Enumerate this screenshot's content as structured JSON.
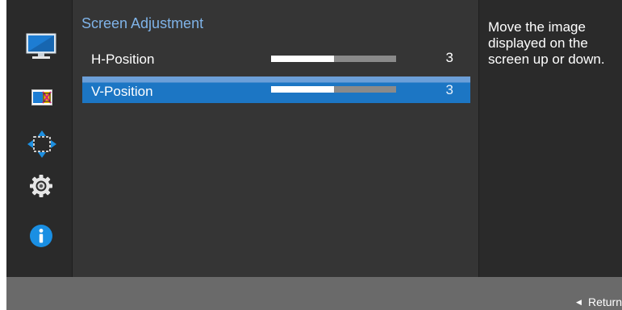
{
  "sidebar": {
    "items": [
      {
        "name": "picture-icon"
      },
      {
        "name": "color-icon"
      },
      {
        "name": "screen-adjustment-icon"
      },
      {
        "name": "system-icon"
      },
      {
        "name": "information-icon"
      }
    ]
  },
  "panel": {
    "title": "Screen Adjustment",
    "rows": [
      {
        "label": "H-Position",
        "value": "3",
        "level": 0.5
      },
      {
        "label": "V-Position",
        "value": "3",
        "level": 0.5,
        "selected": true
      }
    ]
  },
  "description": "Move the image displayed on the screen up or down.",
  "footer": {
    "return_label": "Return"
  },
  "colors": {
    "title": "#7fb3e8",
    "selected_row": "#1c76c4",
    "footer": "#6a6a6a",
    "accent_icon": "#1a8fe3"
  }
}
